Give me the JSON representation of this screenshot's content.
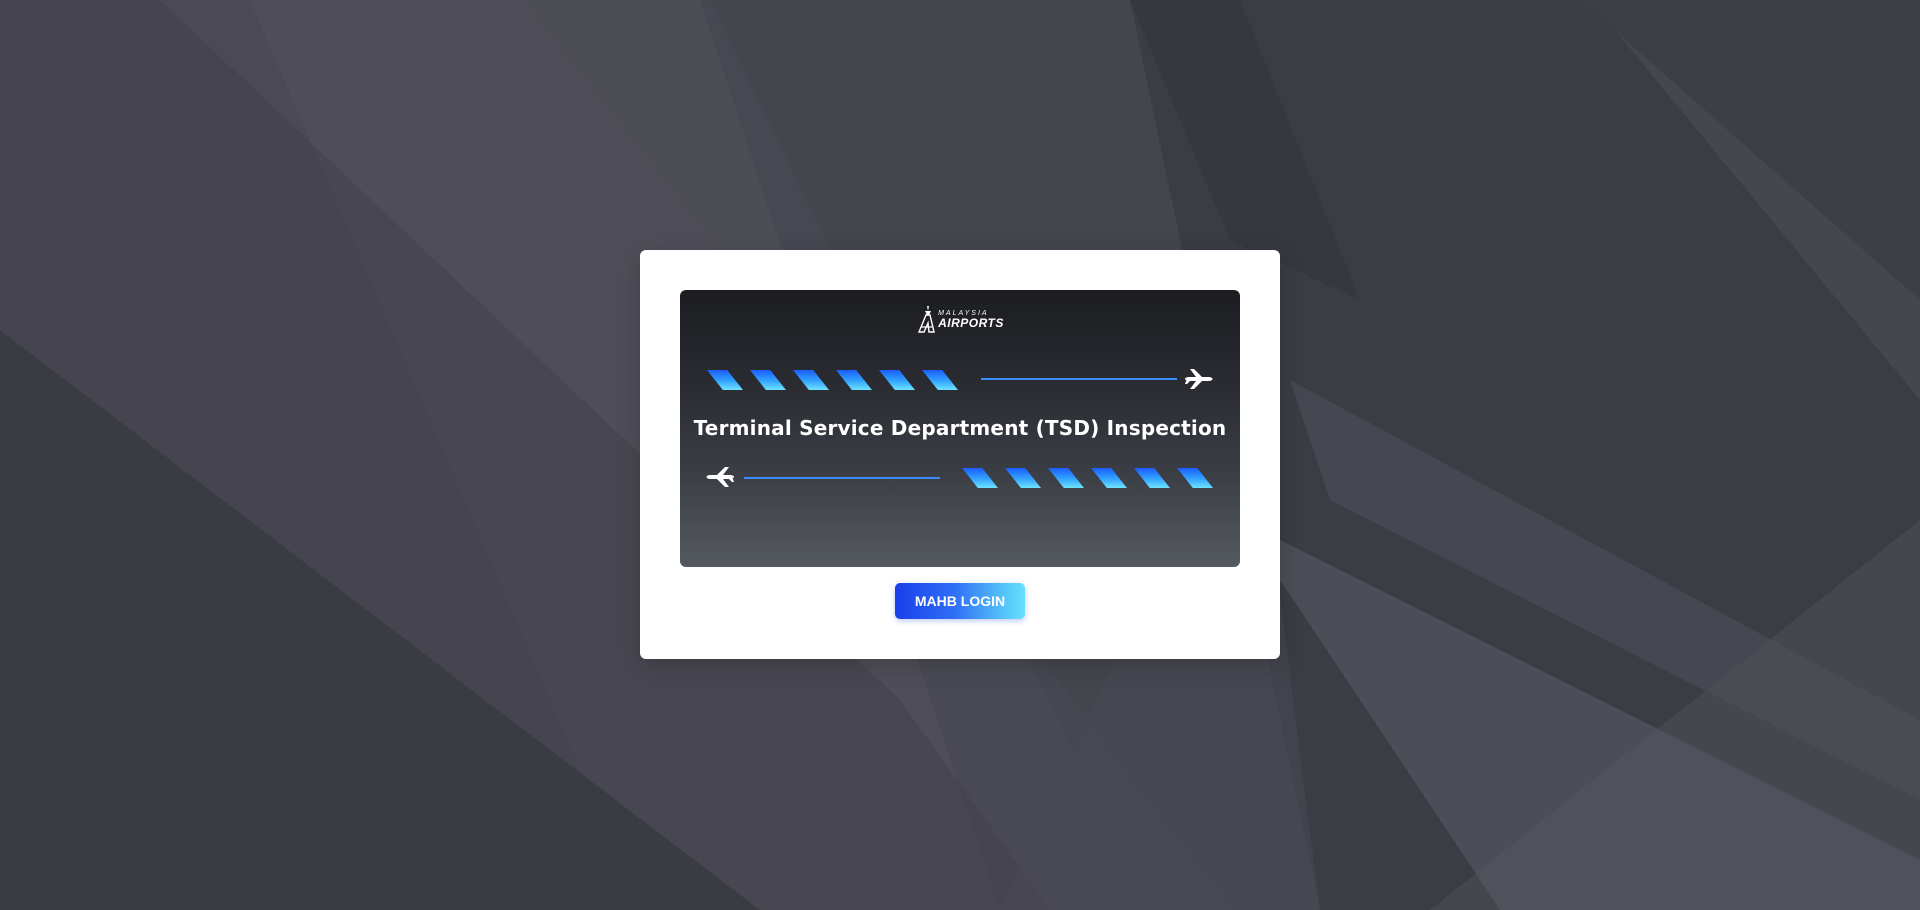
{
  "brand": {
    "logo_top": "MALAYSIA",
    "logo_bottom": "AIRPORTS"
  },
  "banner": {
    "title": "Terminal Service Department (TSD) Inspection"
  },
  "login": {
    "button_label": "MAHB LOGIN"
  },
  "icons": {
    "plane_top": "airplane-icon",
    "plane_bottom": "airplane-icon",
    "logo_mark": "airport-tower-icon"
  },
  "colors": {
    "background": "#46464f",
    "card": "#ffffff",
    "accent_blue": "#1a3fea",
    "accent_cyan": "#68e0fb",
    "stripe_blue": "#34a4ff"
  }
}
